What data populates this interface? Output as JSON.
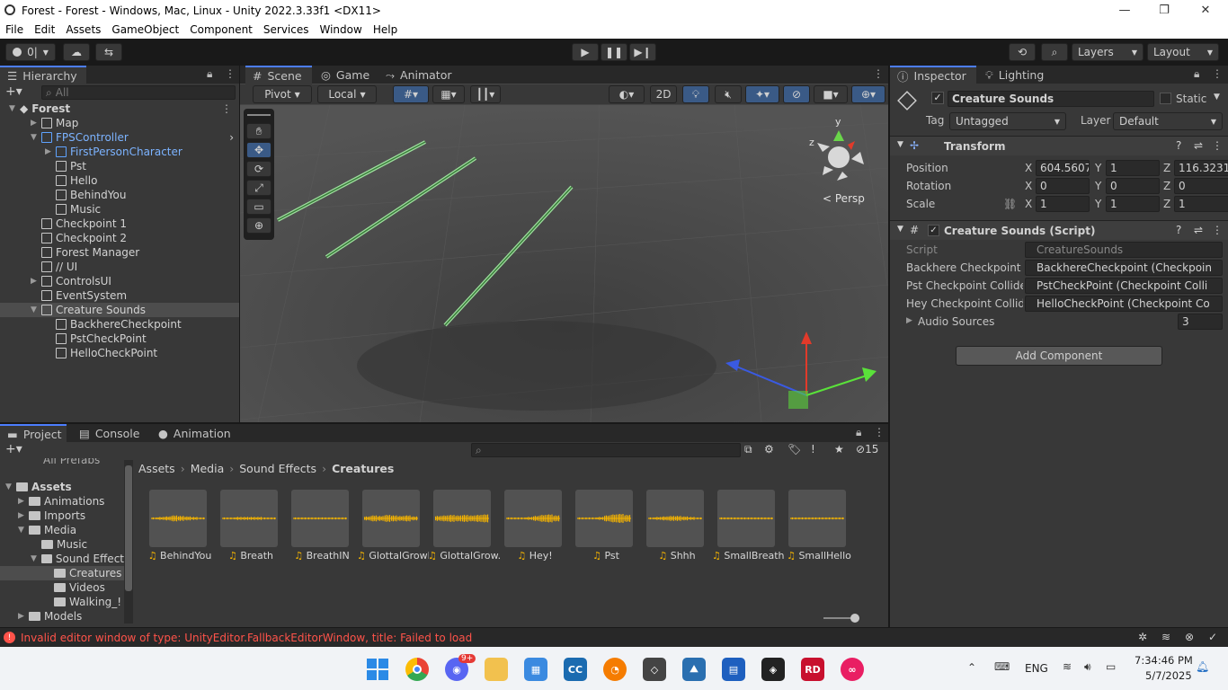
{
  "window": {
    "title": "Forest - Forest - Windows, Mac, Linux - Unity 2022.3.33f1 <DX11>",
    "min": "—",
    "max": "❐",
    "close": "✕"
  },
  "menu": [
    "File",
    "Edit",
    "Assets",
    "GameObject",
    "Component",
    "Services",
    "Window",
    "Help"
  ],
  "toolbar": {
    "account": "0|",
    "layers": "Layers",
    "layout": "Layout"
  },
  "hierarchy": {
    "tab": "Hierarchy",
    "search_placeholder": "All",
    "scene": "Forest",
    "items": [
      {
        "label": "Map",
        "indent": 1,
        "arrow": "▶",
        "blue": false
      },
      {
        "label": "FPSController",
        "indent": 1,
        "arrow": "▼",
        "blue": true
      },
      {
        "label": "FirstPersonCharacter",
        "indent": 2,
        "arrow": "▶",
        "blue": true
      },
      {
        "label": "Pst",
        "indent": 2,
        "arrow": "",
        "blue": false
      },
      {
        "label": "Hello",
        "indent": 2,
        "arrow": "",
        "blue": false
      },
      {
        "label": "BehindYou",
        "indent": 2,
        "arrow": "",
        "blue": false
      },
      {
        "label": "Music",
        "indent": 2,
        "arrow": "",
        "blue": false
      },
      {
        "label": "Checkpoint 1",
        "indent": 1,
        "arrow": "",
        "blue": false
      },
      {
        "label": "Checkpoint 2",
        "indent": 1,
        "arrow": "",
        "blue": false
      },
      {
        "label": "Forest Manager",
        "indent": 1,
        "arrow": "",
        "blue": false
      },
      {
        "label": "// UI",
        "indent": 1,
        "arrow": "",
        "blue": false
      },
      {
        "label": "ControlsUI",
        "indent": 1,
        "arrow": "▶",
        "blue": false
      },
      {
        "label": "EventSystem",
        "indent": 1,
        "arrow": "",
        "blue": false
      },
      {
        "label": "Creature Sounds",
        "indent": 1,
        "arrow": "▼",
        "blue": false,
        "selected": true
      },
      {
        "label": "BackhereCheckpoint",
        "indent": 2,
        "arrow": "",
        "blue": false
      },
      {
        "label": "PstCheckPoint",
        "indent": 2,
        "arrow": "",
        "blue": false
      },
      {
        "label": "HelloCheckPoint",
        "indent": 2,
        "arrow": "",
        "blue": false
      }
    ]
  },
  "scene_tabs": {
    "scene": "Scene",
    "game": "Game",
    "animator": "Animator"
  },
  "scene_toolbar": {
    "pivot": "Pivot",
    "local": "Local",
    "mode2d": "2D",
    "persp": "Persp",
    "gizmo_y": "y",
    "gizmo_z": "z"
  },
  "inspector": {
    "tab": "Inspector",
    "lighting_tab": "Lighting",
    "object_name": "Creature Sounds",
    "static_label": "Static",
    "tag_label": "Tag",
    "tag_value": "Untagged",
    "layer_label": "Layer",
    "layer_value": "Default",
    "transform": {
      "title": "Transform",
      "position_label": "Position",
      "rotation_label": "Rotation",
      "scale_label": "Scale",
      "position": {
        "x": "604.5607",
        "y": "1",
        "z": "116.3231"
      },
      "rotation": {
        "x": "0",
        "y": "0",
        "z": "0"
      },
      "scale": {
        "x": "1",
        "y": "1",
        "z": "1"
      }
    },
    "script": {
      "title": "Creature Sounds (Script)",
      "script_label": "Script",
      "script_value": "CreatureSounds",
      "f1_label": "Backhere Checkpoint C",
      "f1_value": "BackhereCheckpoint (Checkpoin",
      "f2_label": "Pst Checkpoint Collide",
      "f2_value": "PstCheckPoint (Checkpoint Colli",
      "f3_label": "Hey Checkpoint Collide",
      "f3_value": "HelloCheckPoint (Checkpoint Co",
      "audio_label": "Audio Sources",
      "audio_value": "3"
    },
    "add_component": "Add Component",
    "axis_x": "X",
    "axis_y": "Y",
    "axis_z": "Z"
  },
  "project": {
    "tabs": {
      "project": "Project",
      "console": "Console",
      "animation": "Animation"
    },
    "hidden_count": "15",
    "partial_top": "All Prefabs",
    "tree": [
      {
        "label": "Assets",
        "indent": 0,
        "arrow": "▼",
        "bold": true
      },
      {
        "label": "Animations",
        "indent": 1,
        "arrow": "▶"
      },
      {
        "label": "Imports",
        "indent": 1,
        "arrow": "▶"
      },
      {
        "label": "Media",
        "indent": 1,
        "arrow": "▼"
      },
      {
        "label": "Music",
        "indent": 2,
        "arrow": ""
      },
      {
        "label": "Sound Effect",
        "indent": 2,
        "arrow": "▼"
      },
      {
        "label": "Creatures",
        "indent": 3,
        "arrow": "",
        "selected": true
      },
      {
        "label": "Videos",
        "indent": 3,
        "arrow": ""
      },
      {
        "label": "Walking_!",
        "indent": 3,
        "arrow": ""
      },
      {
        "label": "Models",
        "indent": 1,
        "arrow": "▶"
      }
    ],
    "breadcrumb": [
      "Assets",
      "Media",
      "Sound Effects",
      "Creatures"
    ],
    "assets": [
      "BehindYou",
      "Breath",
      "BreathIN",
      "GlottalGrowl",
      "GlottalGrow...",
      "Hey!",
      "Pst",
      "Shhh",
      "SmallBreath",
      "SmallHello"
    ]
  },
  "status": {
    "error": "Invalid editor window of type: UnityEditor.FallbackEditorWindow, title: Failed to load"
  },
  "taskbar": {
    "lang": "ENG",
    "time": "7:34:46 PM",
    "date": "5/7/2025",
    "discord_badge": "9+"
  },
  "colors": {
    "accent": "#4c7eff",
    "error": "#ff534a",
    "selected": "#2c5d87"
  }
}
